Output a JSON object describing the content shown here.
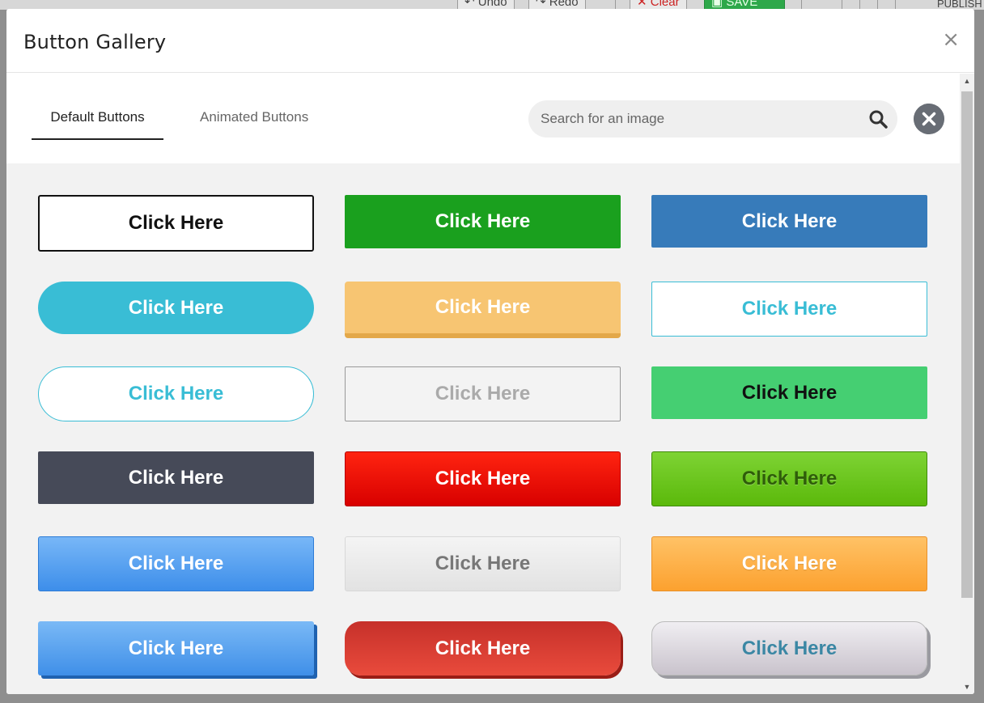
{
  "background_toolbar": {
    "undo_label": "Undo",
    "redo_label": "Redo",
    "clear_label": "Clear",
    "save_label": "SAVE",
    "publish_label": "PUBLISH"
  },
  "modal": {
    "title": "Button Gallery",
    "close_glyph": "×"
  },
  "tabs": [
    {
      "label": "Default Buttons",
      "active": true
    },
    {
      "label": "Animated Buttons",
      "active": false
    }
  ],
  "search": {
    "placeholder": "Search for an image",
    "value": ""
  },
  "buttons": [
    {
      "label": "Click Here"
    },
    {
      "label": "Click Here"
    },
    {
      "label": "Click Here"
    },
    {
      "label": "Click Here"
    },
    {
      "label": "Click Here"
    },
    {
      "label": "Click Here"
    },
    {
      "label": "Click Here"
    },
    {
      "label": "Click Here"
    },
    {
      "label": "Click Here"
    },
    {
      "label": "Click Here"
    },
    {
      "label": "Click Here"
    },
    {
      "label": "Click Here"
    },
    {
      "label": "Click Here"
    },
    {
      "label": "Click Here"
    },
    {
      "label": "Click Here"
    },
    {
      "label": "Click Here"
    },
    {
      "label": "Click Here"
    },
    {
      "label": "Click Here"
    }
  ],
  "icons": {
    "search": "search-icon",
    "clear": "clear-circle-icon",
    "close": "close-icon"
  },
  "colors": {
    "accent_green": "#1aa01e",
    "accent_blue": "#377bba",
    "accent_teal": "#39bdd5"
  }
}
